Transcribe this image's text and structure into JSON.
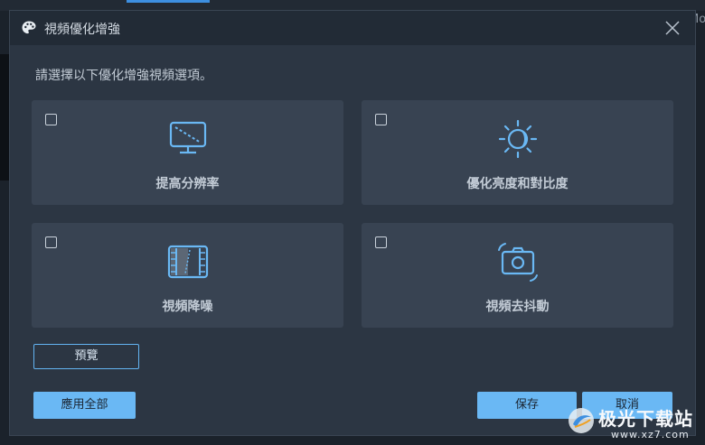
{
  "dialog": {
    "title": "視頻優化增強",
    "instruction": "請選擇以下優化增強視頻選項。"
  },
  "options": [
    {
      "label": "提高分辨率",
      "icon": "monitor-icon",
      "checked": false
    },
    {
      "label": "優化亮度和對比度",
      "icon": "brightness-icon",
      "checked": false
    },
    {
      "label": "視頻降噪",
      "icon": "film-icon",
      "checked": false
    },
    {
      "label": "視頻去抖動",
      "icon": "camera-stabilize-icon",
      "checked": false
    }
  ],
  "buttons": {
    "preview": "預覽",
    "apply_all": "應用全部",
    "save": "保存",
    "cancel": "取消"
  },
  "background": {
    "right_fragment": "Mo"
  },
  "watermark": {
    "text": "极光下载站",
    "url": "www.xz7.com"
  },
  "colors": {
    "accent": "#6ab8f4",
    "dialog_bg": "#2c3643",
    "card_bg": "#384352",
    "icon": "#6ab8f4"
  }
}
